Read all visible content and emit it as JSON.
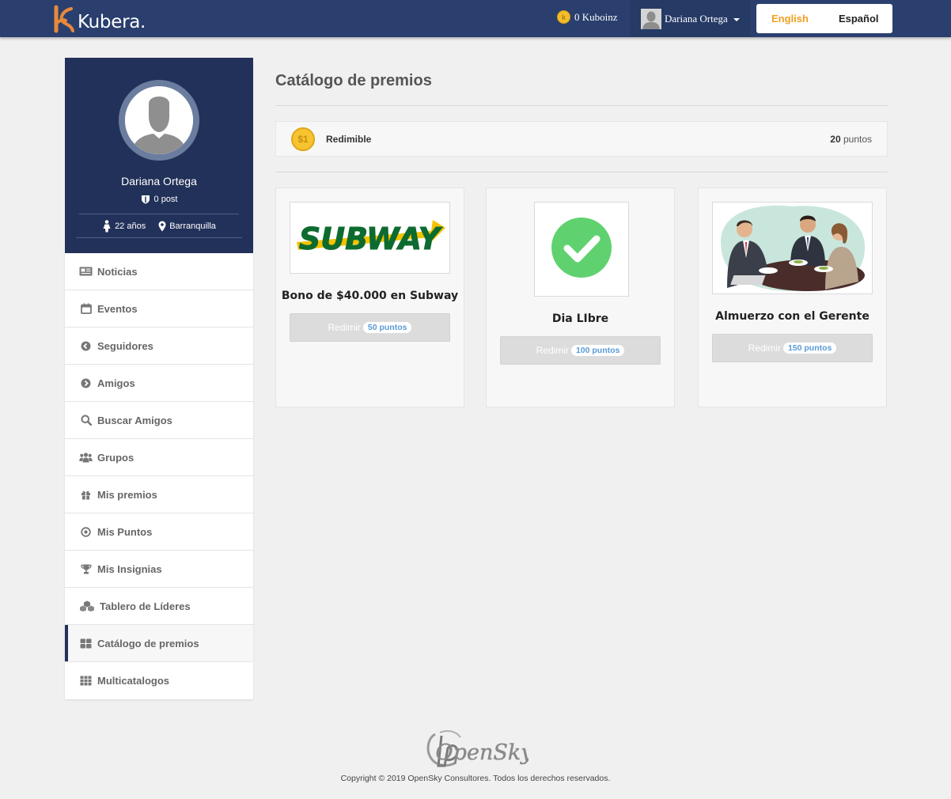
{
  "header": {
    "logo_text": "Kubera.",
    "kuboinz": "0 Kuboinz",
    "user_name": "Dariana Ortega",
    "languages": [
      "English",
      "Español"
    ],
    "active_language": "English",
    "colors": {
      "bar": "#2a3f6e",
      "accent": "#f0a020"
    }
  },
  "profile": {
    "name": "Dariana Ortega",
    "posts": "0 post",
    "age": "22 años",
    "city": "Barranquilla"
  },
  "menu": [
    {
      "label": "Noticias",
      "icon": "newspaper-icon"
    },
    {
      "label": "Eventos",
      "icon": "calendar-icon"
    },
    {
      "label": "Seguidores",
      "icon": "arrow-circle-left-icon"
    },
    {
      "label": "Amigos",
      "icon": "arrow-circle-right-icon"
    },
    {
      "label": "Buscar Amigos",
      "icon": "search-icon"
    },
    {
      "label": "Grupos",
      "icon": "group-icon"
    },
    {
      "label": "Mis premios",
      "icon": "gift-icon"
    },
    {
      "label": "Mis Puntos",
      "icon": "dot-circle-icon"
    },
    {
      "label": "Mis Insignias",
      "icon": "trophy-icon"
    },
    {
      "label": "Tablero de Líderes",
      "icon": "cubes-icon"
    },
    {
      "label": "Catálogo de premios",
      "icon": "th-large-icon",
      "active": true
    },
    {
      "label": "Multicatalogos",
      "icon": "th-icon"
    }
  ],
  "main": {
    "title": "Catálogo de premios",
    "points_bar": {
      "coin": "$1",
      "label": "Redimible",
      "points_value": "20",
      "points_unit": "puntos"
    },
    "rewards": [
      {
        "title": "Bono de $40.000 en Subway",
        "button": "Redimir",
        "points": "50 puntos",
        "image": "subway-logo",
        "logo_text": "SUBWAY"
      },
      {
        "title": "Dia LIbre",
        "button": "Redimir",
        "points": "100 puntos",
        "image": "green-check-icon"
      },
      {
        "title": "Almuerzo con el Gerente",
        "button": "Redimir",
        "points": "150 puntos",
        "image": "business-lunch-illustration"
      }
    ]
  },
  "footer": {
    "logo_text": "OpenSky",
    "copyright": "Copyright © 2019 OpenSky Consultores. Todos los derechos reservados."
  }
}
